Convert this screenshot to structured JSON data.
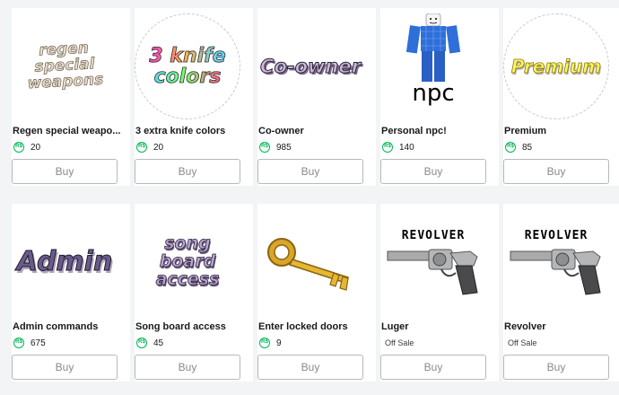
{
  "currency_icon": "robux-icon",
  "currency_symbol": "R$",
  "accent_color": "#02b757",
  "items": [
    {
      "name": "Regen special weapo...",
      "price": "20",
      "buy_label": "Buy",
      "thumbnail_text": "regen special weapons",
      "thumbnail_icon": "regen-weapons-thumbnail"
    },
    {
      "name": "3 extra knife colors",
      "price": "20",
      "buy_label": "Buy",
      "thumbnail_text": "3 knife colors",
      "thumbnail_icon": "knife-colors-thumbnail"
    },
    {
      "name": "Co-owner",
      "price": "985",
      "buy_label": "Buy",
      "thumbnail_text": "Co-owner",
      "thumbnail_icon": "co-owner-thumbnail"
    },
    {
      "name": "Personal npc!",
      "price": "140",
      "buy_label": "Buy",
      "thumbnail_text": "npc",
      "thumbnail_icon": "npc-avatar-thumbnail"
    },
    {
      "name": "Premium",
      "price": "85",
      "buy_label": "Buy",
      "thumbnail_text": "Premium",
      "thumbnail_icon": "premium-thumbnail"
    },
    {
      "name": "Admin commands",
      "price": "675",
      "buy_label": "Buy",
      "thumbnail_text": "Admin",
      "thumbnail_icon": "admin-thumbnail"
    },
    {
      "name": "Song board access",
      "price": "45",
      "buy_label": "Buy",
      "thumbnail_text": "song board access",
      "thumbnail_icon": "song-board-thumbnail"
    },
    {
      "name": "Enter locked doors",
      "price": "9",
      "buy_label": "Buy",
      "thumbnail_text": "",
      "thumbnail_icon": "key-icon"
    },
    {
      "name": "Luger",
      "status": "Off Sale",
      "buy_label": "Buy",
      "thumbnail_text": "REVOLVER",
      "thumbnail_icon": "revolver-icon"
    },
    {
      "name": "Revolver",
      "status": "Off Sale",
      "buy_label": "Buy",
      "thumbnail_text": "REVOLVER",
      "thumbnail_icon": "revolver-icon"
    }
  ]
}
